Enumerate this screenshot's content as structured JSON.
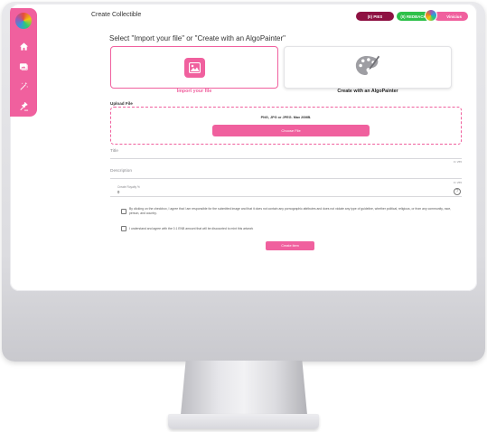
{
  "header": {
    "title": "Create Collectible",
    "pies_label": "(0) PIES",
    "redback_label": "(0) REDBACK",
    "user_name": "Vinicius"
  },
  "sidebar": {
    "items": [
      {
        "icon": "home-icon"
      },
      {
        "icon": "gallery-icon"
      },
      {
        "icon": "magic-wand-icon"
      },
      {
        "icon": "gavel-icon"
      }
    ]
  },
  "form": {
    "section_title": "Select \"Import your file\" or \"Create with an AlgoPainter\"",
    "import_label": "Import your file",
    "algo_label": "Create with an AlgoPainter",
    "upload_title": "Upload File",
    "upload_hint": "PNG, JPG or JPEG. Max 20MB.",
    "choose_file": "Choose File",
    "title_label": "Title",
    "title_counter": "0 / 255",
    "description_label": "Description",
    "description_counter": "0 / 255",
    "royalty_label": "Create Royalty %",
    "royalty_value": "0",
    "agree_text": "By clicking on the checkbox, I agree that I am responsible for the submitted image and that it does not contain any pornographic attributes and does not violate any type of guideline, whether political, religious, or from any community, race, person, and country.",
    "fee_text": "I understand and agree with the 0.1 ENB amount that will be discounted to mint this artwork",
    "create_button": "Create item"
  },
  "colors": {
    "accent": "#f0609e",
    "pies": "#8e1142",
    "redback": "#2ec04a"
  }
}
